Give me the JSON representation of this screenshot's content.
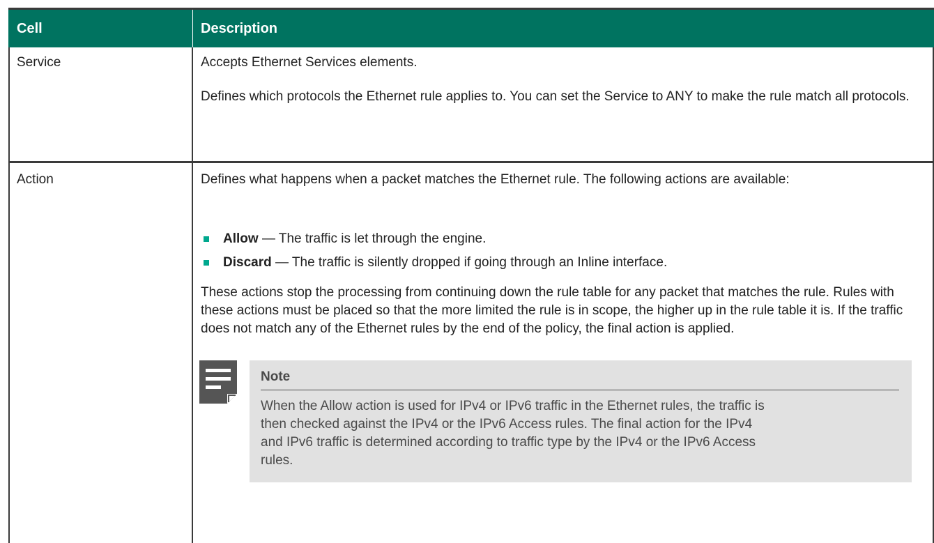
{
  "table": {
    "headers": {
      "cell": "Cell",
      "description": "Description"
    },
    "rows": [
      {
        "cell": "Service",
        "paragraphs": [
          "Accepts Ethernet Services elements.",
          "Defines which protocols the Ethernet rule applies to. You can set the Service to ANY to make the rule match all protocols."
        ]
      },
      {
        "cell": "Action",
        "intro": "Defines what happens when a packet matches the Ethernet rule. The following actions are available:",
        "bullets": [
          {
            "term": "Allow",
            "text": " — The traffic is let through the engine."
          },
          {
            "term": "Discard",
            "text": " — The traffic is silently dropped if going through an Inline interface."
          }
        ],
        "body": "These actions stop the processing from continuing down the rule table for any packet that matches the rule. Rules with these actions must be placed so that the more limited the rule is in scope, the higher up in the rule table it is. If the traffic does not match any of the Ethernet rules by the end of the policy, the final action is applied.",
        "note": {
          "title": "Note",
          "icon": "note-icon",
          "text": "When the Allow action is used for IPv4 or IPv6 traffic in the Ethernet rules, the traffic is then checked against the IPv4 or the IPv6 Access rules. The final action for the IPv4 and IPv6 traffic is determined according to traffic type by the IPv4 or the IPv6 Access rules."
        }
      }
    ]
  },
  "colors": {
    "header_bg": "#007360",
    "bullet": "#00a88e",
    "note_bg": "#e1e1e1",
    "rule_lines": "#3a3a3a"
  }
}
